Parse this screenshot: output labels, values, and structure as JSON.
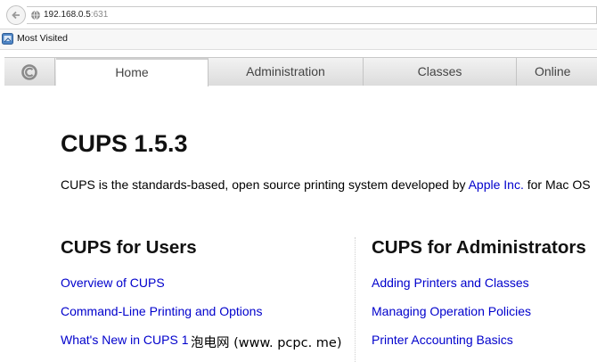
{
  "browser": {
    "url_host": "192.168.0.5",
    "url_port": ":631",
    "bookmarks": [
      {
        "label": "Most Visited"
      }
    ]
  },
  "nav": {
    "tabs": [
      {
        "label": "Home",
        "active": true
      },
      {
        "label": "Administration",
        "active": false
      },
      {
        "label": "Classes",
        "active": false
      },
      {
        "label": "Online",
        "active": false
      }
    ]
  },
  "main": {
    "title": "CUPS 1.5.3",
    "intro_before": "CUPS is the standards-based, open source printing system developed by ",
    "intro_link": "Apple Inc.",
    "intro_after": " for Mac OS",
    "users": {
      "heading": "CUPS for Users",
      "links": [
        "Overview of CUPS",
        "Command-Line Printing and Options",
        "What's New in CUPS 1"
      ]
    },
    "admins": {
      "heading": "CUPS for Administrators",
      "links": [
        "Adding Printers and Classes",
        "Managing Operation Policies",
        "Printer Accounting Basics"
      ]
    }
  },
  "watermark": "泡电网 (www. pcpc. me)",
  "colors": {
    "link": "#0000cc",
    "tabbar": "#e6e6e6",
    "active_tab": "#ffffff"
  }
}
